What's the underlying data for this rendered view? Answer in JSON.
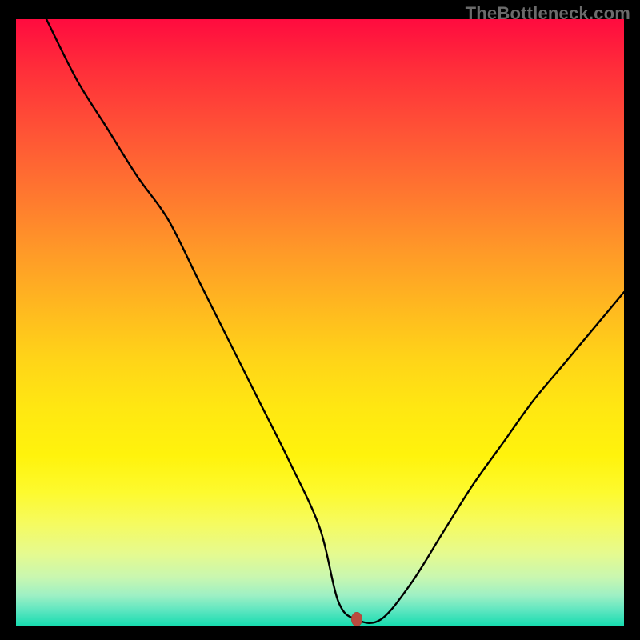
{
  "watermark": "TheBottleneck.com",
  "colors": {
    "frame_bg": "#000000",
    "curve": "#000000",
    "marker": "#ba4b3f",
    "gradient_stops": [
      "#ff0b3f",
      "#ff2d3a",
      "#ff5136",
      "#ff7430",
      "#ff9828",
      "#ffba1f",
      "#ffd418",
      "#ffe712",
      "#fff30c",
      "#fdfa2e",
      "#f6fb5e",
      "#e6fa8e",
      "#c9f7b0",
      "#9ef0c4",
      "#5de6c0",
      "#18dcb0"
    ]
  },
  "chart_data": {
    "type": "line",
    "title": "",
    "xlabel": "",
    "ylabel": "",
    "xlim": [
      0,
      100
    ],
    "ylim": [
      0,
      100
    ],
    "grid": false,
    "legend": false,
    "marker": {
      "x": 56,
      "y": 1,
      "color": "#ba4b3f"
    },
    "series": [
      {
        "name": "curve",
        "color": "#000000",
        "x": [
          5,
          10,
          15,
          20,
          25,
          30,
          35,
          40,
          45,
          50,
          53,
          56,
          60,
          65,
          70,
          75,
          80,
          85,
          90,
          95,
          100
        ],
        "y": [
          100,
          90,
          82,
          74,
          67,
          57,
          47,
          37,
          27,
          16,
          4,
          1,
          1,
          7,
          15,
          23,
          30,
          37,
          43,
          49,
          55
        ]
      }
    ]
  }
}
